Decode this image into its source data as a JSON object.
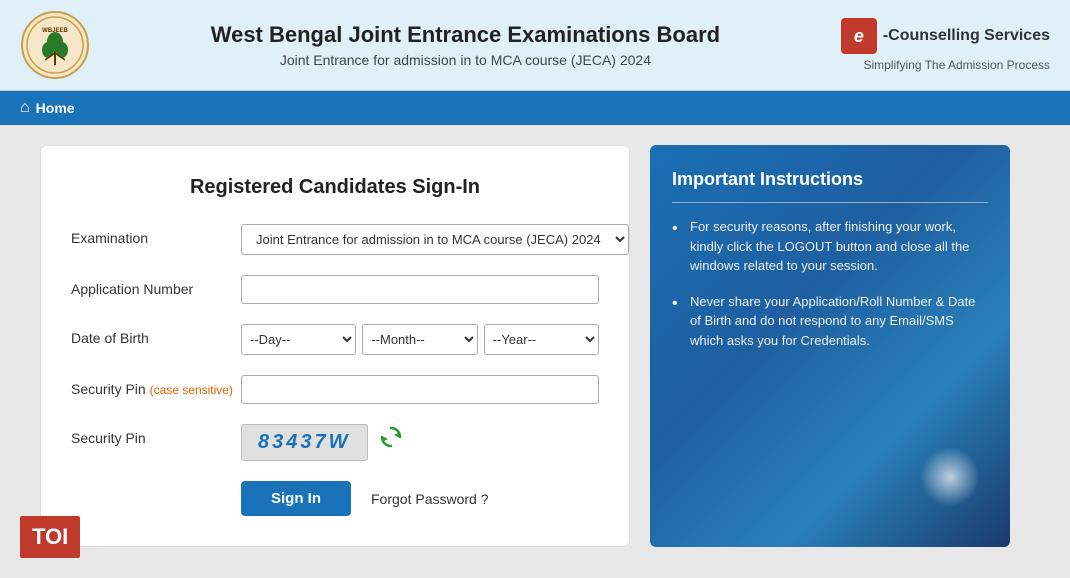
{
  "header": {
    "main_title": "West Bengal Joint Entrance Examinations Board",
    "sub_title": "Joint Entrance for admission in to MCA course (JECA) 2024",
    "ecounselling_label": "-Counselling Services",
    "ecounselling_icon": "e",
    "ecounselling_tagline": "Simplifying The Admission Process"
  },
  "navbar": {
    "home_label": "Home"
  },
  "signin": {
    "title": "Registered Candidates Sign-In",
    "examination_label": "Examination",
    "examination_value": "Joint Entrance for admission in to MCA course (JECA) 2024",
    "application_number_label": "Application Number",
    "application_number_placeholder": "",
    "dob_label": "Date of Birth",
    "dob_day_placeholder": "--Day--",
    "dob_month_placeholder": "--Month--",
    "dob_year_placeholder": "--Year--",
    "security_pin_label": "Security Pin",
    "security_pin_note": "(case sensitive)",
    "security_pin_input_label": "Security Pin",
    "security_pin_value": "83437W",
    "signin_button": "Sign In",
    "forgot_password": "Forgot Password ?"
  },
  "instructions": {
    "title": "Important Instructions",
    "items": [
      "For security reasons, after finishing your work, kindly click the LOGOUT button and close all the windows related to your session.",
      "Never share your Application/Roll Number & Date of Birth and do not respond to any Email/SMS which asks you for Credentials."
    ]
  },
  "toi": {
    "label": "TOI"
  }
}
